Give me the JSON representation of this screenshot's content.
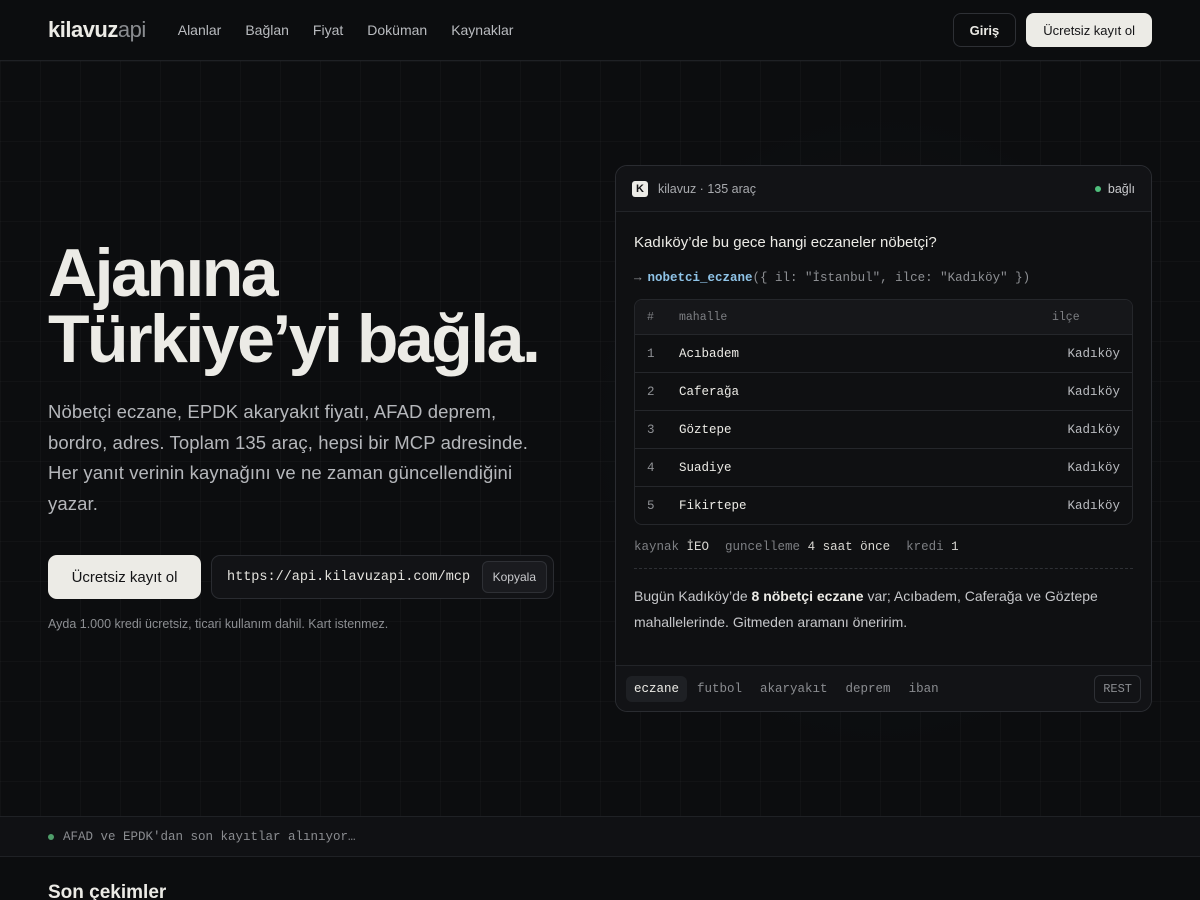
{
  "nav": {
    "logo_a": "kilavuz",
    "logo_b": "api",
    "links": [
      "Alanlar",
      "Bağlan",
      "Fiyat",
      "Doküman",
      "Kaynaklar"
    ],
    "login": "Giriş",
    "signup": "Ücretsiz kayıt ol"
  },
  "hero": {
    "title_line1": "Ajanına",
    "title_line2": "Türkiye’yi bağla.",
    "subtitle": "Nöbetçi eczane, EPDK akaryakıt fiyatı, AFAD deprem, bordro, adres. Toplam 135 araç, hepsi bir MCP adresinde. Her yanıt verinin kaynağını ve ne zaman güncellendiğini yazar.",
    "cta": "Ücretsiz kayıt ol",
    "url": "https://api.kilavuzapi.com/mcp",
    "copy": "Kopyala",
    "note": "Ayda 1.000 kredi ücretsiz, ticari kullanım dahil. Kart istenmez."
  },
  "card": {
    "icon": "K",
    "title": "kilavuz · 135 araç",
    "status": "bağlı",
    "question": "Kadıköy’de bu gece hangi eczaneler nöbetçi?",
    "arrow": "→",
    "fn": "nobetci_eczane",
    "args": "({ il: \"İstanbul\", ilce: \"Kadıköy\" })",
    "table": {
      "headers": [
        "#",
        "mahalle",
        "ilçe"
      ],
      "rows": [
        [
          "1",
          "Acıbadem",
          "Kadıköy"
        ],
        [
          "2",
          "Caferağa",
          "Kadıköy"
        ],
        [
          "3",
          "Göztepe",
          "Kadıköy"
        ],
        [
          "4",
          "Suadiye",
          "Kadıköy"
        ],
        [
          "5",
          "Fikirtepe",
          "Kadıköy"
        ]
      ]
    },
    "meta": {
      "source_k": "kaynak",
      "source_v": "İEO",
      "update_k": "guncelleme",
      "update_v": "4 saat önce",
      "credit_k": "kredi",
      "credit_v": "1"
    },
    "answer_pre": "Bugün Kadıköy’de ",
    "answer_bold": "8 nöbetçi eczane",
    "answer_post": " var; Acıbadem, Caferağa ve Göztepe mahallelerinde. Gitmeden aramanı öneririm.",
    "tabs": [
      "eczane",
      "futbol",
      "akaryakıt",
      "deprem",
      "iban"
    ],
    "rest": "REST"
  },
  "live": {
    "text": "AFAD ve EPDK'dan son kayıtlar alınıyor…"
  },
  "section": {
    "title": "Son çekimler"
  },
  "colors": {
    "accent": "#ecebe6",
    "status_green": "#4fbf7c",
    "background": "#0c0d0f"
  }
}
